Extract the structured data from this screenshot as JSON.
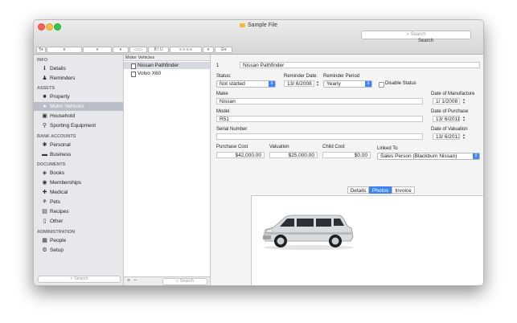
{
  "window": {
    "title": "Sample File",
    "search_placeholder": "Search",
    "search_label": "Search"
  },
  "sidebar": {
    "sections": [
      {
        "header": "INFO",
        "items": [
          {
            "label": "Details",
            "icon": "info-icon"
          },
          {
            "label": "Reminders",
            "icon": "bell-icon"
          }
        ]
      },
      {
        "header": "ASSETS",
        "items": [
          {
            "label": "Property",
            "icon": "house-icon"
          },
          {
            "label": "Motor Vehicles",
            "icon": "car-icon",
            "selected": true
          },
          {
            "label": "Household",
            "icon": "tv-icon"
          },
          {
            "label": "Sporting Equipment",
            "icon": "bike-icon"
          }
        ]
      },
      {
        "header": "BANK ACCOUNTS",
        "items": [
          {
            "label": "Personal",
            "icon": "person-icon"
          },
          {
            "label": "Business",
            "icon": "briefcase-icon"
          }
        ]
      },
      {
        "header": "DOCUMENTS",
        "items": [
          {
            "label": "Books",
            "icon": "book-icon"
          },
          {
            "label": "Memberships",
            "icon": "membership-icon"
          },
          {
            "label": "Medical",
            "icon": "medical-icon"
          },
          {
            "label": "Pets",
            "icon": "paw-icon"
          },
          {
            "label": "Recipes",
            "icon": "recipe-icon"
          },
          {
            "label": "Other",
            "icon": "document-icon"
          }
        ]
      },
      {
        "header": "ADMINISTRATION",
        "items": [
          {
            "label": "People",
            "icon": "people-icon"
          },
          {
            "label": "Setup",
            "icon": "gear-icon"
          }
        ]
      }
    ],
    "search_placeholder": "Search"
  },
  "list": {
    "header": "Motor Vehicles",
    "rows": [
      "Nissan Pathfinder",
      "Volvo X60"
    ],
    "selected_index": 0,
    "add_label": "+",
    "remove_label": "−",
    "search_placeholder": "Search"
  },
  "detail": {
    "record_number": "1",
    "name": "Nissan Pathfinder",
    "status_label": "Status:",
    "status_value": "Not started",
    "reminder_date_label": "Reminder Date:",
    "reminder_date_value": "13/  6/2008",
    "reminder_period_label": "Reminder Period",
    "reminder_period_value": "Yearly",
    "disable_status_label": "Disable Status",
    "make_label": "Make",
    "make_value": "Nissan",
    "model_label": "Model",
    "model_value": "R51",
    "serial_label": "Serial Number",
    "serial_value": "",
    "dom_label": "Date of Manufacture",
    "dom_value": "1/  1/2008",
    "dop_label": "Date of Purchase",
    "dop_value": "13/  6/2011",
    "dov_label": "Date of Valuation",
    "dov_value": "13/  6/2013",
    "purchase_cost_label": "Purchase Cost",
    "purchase_cost_value": "$42,000.00",
    "valuation_label": "Valuation",
    "valuation_value": "$25,000.00",
    "child_cost_label": "Child Cost",
    "child_cost_value": "$0.00",
    "linked_to_label": "Linked To",
    "linked_to_value": "Sales Person (Blackburn Nissan)",
    "tabs": [
      "Details",
      "Photos",
      "Invoice"
    ],
    "active_tab": "Photos"
  },
  "colors": {
    "accent": "#3f86f7",
    "sidebar_bg": "#e6e8eb",
    "selected_row": "#b9bfc8"
  }
}
